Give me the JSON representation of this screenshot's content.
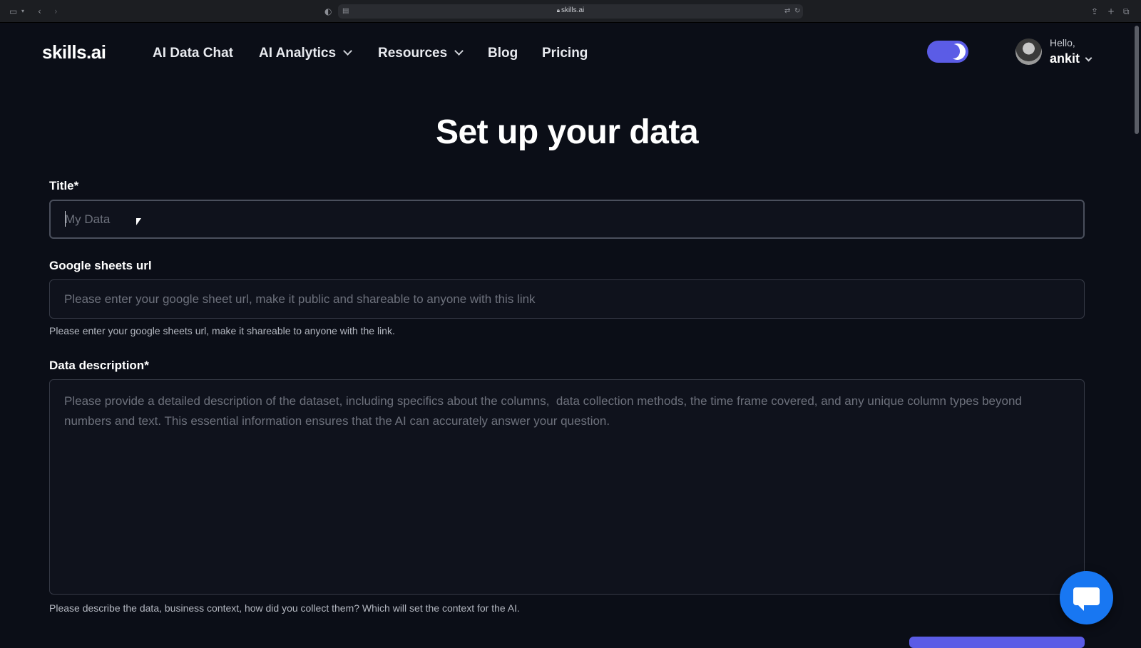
{
  "browser": {
    "url": "skills.ai",
    "lock_icon": "lock-icon",
    "sidebar_icon": "sidebar-toggle-icon",
    "back_icon": "back-icon",
    "forward_icon": "forward-icon",
    "shield_icon": "shield-icon",
    "reader_icon": "reader-icon",
    "translate_icon": "translate-icon",
    "reload_icon": "reload-icon",
    "share_icon": "share-icon",
    "new_tab_icon": "plus-icon",
    "tabs_icon": "tab-overview-icon"
  },
  "nav": {
    "logo": "skills.ai",
    "links": [
      {
        "label": "AI Data Chat",
        "has_dropdown": false
      },
      {
        "label": "AI Analytics",
        "has_dropdown": true
      },
      {
        "label": "Resources",
        "has_dropdown": true
      },
      {
        "label": "Blog",
        "has_dropdown": false
      },
      {
        "label": "Pricing",
        "has_dropdown": false
      }
    ],
    "theme_toggle": {
      "state": "dark",
      "accent": "#5b5ce6"
    },
    "user": {
      "greeting": "Hello,",
      "name": "ankit"
    }
  },
  "form": {
    "heading": "Set up your data",
    "title_field": {
      "label": "Title*",
      "placeholder": "My Data",
      "value": ""
    },
    "sheets_field": {
      "label": "Google sheets url",
      "placeholder": "Please enter your google sheet url, make it public and shareable to anyone with this link",
      "value": "",
      "helper": "Please enter your google sheets url, make it shareable to anyone with the link."
    },
    "description_field": {
      "label": "Data description*",
      "placeholder": "Please provide a detailed description of the dataset, including specifics about the columns,  data collection methods, the time frame covered, and any unique column types beyond numbers and text. This essential information ensures that the AI can accurately answer your question.",
      "value": "",
      "helper": "Please describe the data, business context, how did you collect them? Which will set the context for the AI."
    }
  },
  "colors": {
    "background": "#0b0e17",
    "accent": "#5b5ce6",
    "chat_widget": "#1877f2"
  }
}
